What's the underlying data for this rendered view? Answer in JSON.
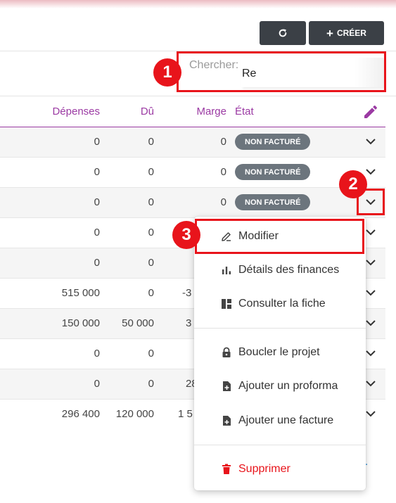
{
  "toolbar": {
    "create_label": "CRÉER"
  },
  "search": {
    "label": "Chercher:",
    "value": "Re"
  },
  "columns": {
    "depenses": "Dépenses",
    "du": "Dû",
    "marge": "Marge",
    "etat": "État"
  },
  "rows": [
    {
      "depenses": "0",
      "du": "0",
      "marge": "0",
      "etat": "NON FACTURÉ"
    },
    {
      "depenses": "0",
      "du": "0",
      "marge": "0",
      "etat": "NON FACTURÉ"
    },
    {
      "depenses": "0",
      "du": "0",
      "marge": "0",
      "etat": "NON FACTURÉ"
    },
    {
      "depenses": "0",
      "du": "0",
      "marge": "",
      "etat": ""
    },
    {
      "depenses": "0",
      "du": "0",
      "marge": "",
      "etat": ""
    },
    {
      "depenses": "515 000",
      "du": "0",
      "marge": "-3",
      "etat": ""
    },
    {
      "depenses": "150 000",
      "du": "50 000",
      "marge": "3",
      "etat": ""
    },
    {
      "depenses": "0",
      "du": "0",
      "marge": "",
      "etat": ""
    },
    {
      "depenses": "0",
      "du": "0",
      "marge": "28",
      "etat": ""
    },
    {
      "depenses": "296 400",
      "du": "120 000",
      "marge": "1 5",
      "etat": ""
    }
  ],
  "menu": {
    "modifier": "Modifier",
    "details_finances": "Détails des finances",
    "consulter_fiche": "Consulter la fiche",
    "boucler_projet": "Boucler le projet",
    "ajouter_proforma": "Ajouter un proforma",
    "ajouter_facture": "Ajouter une facture",
    "supprimer": "Supprimer"
  },
  "annotations": {
    "one": "1",
    "two": "2",
    "three": "3"
  },
  "pagination": {
    "fragment": "v."
  },
  "colors": {
    "accent_purple": "#9b3aa3",
    "annotation_red": "#e8141b",
    "badge_gray": "#6c757d",
    "button_dark": "#3b4046",
    "danger": "#e8141b"
  }
}
